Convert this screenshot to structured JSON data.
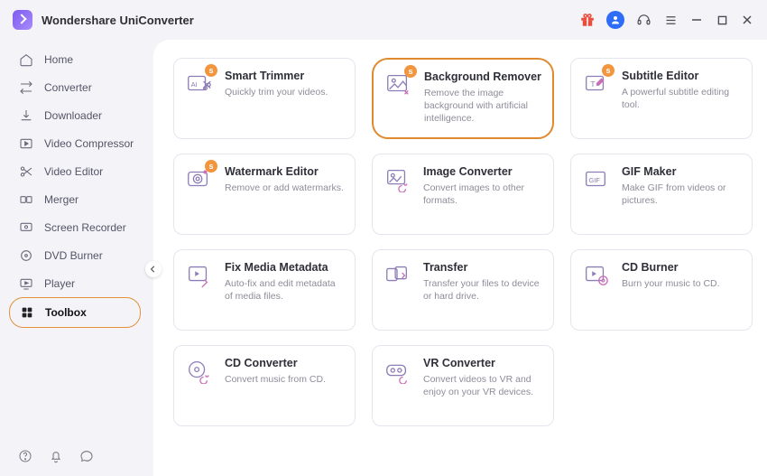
{
  "app": {
    "title": "Wondershare UniConverter"
  },
  "sidebar": {
    "items": [
      {
        "label": "Home"
      },
      {
        "label": "Converter"
      },
      {
        "label": "Downloader"
      },
      {
        "label": "Video Compressor"
      },
      {
        "label": "Video Editor"
      },
      {
        "label": "Merger"
      },
      {
        "label": "Screen Recorder"
      },
      {
        "label": "DVD Burner"
      },
      {
        "label": "Player"
      },
      {
        "label": "Toolbox"
      }
    ],
    "active_index": 9
  },
  "tools": [
    {
      "title": "Smart Trimmer",
      "desc": "Quickly trim your videos.",
      "badge": "s"
    },
    {
      "title": "Background Remover",
      "desc": "Remove the image background with artificial intelligence.",
      "badge": "s",
      "highlight": true
    },
    {
      "title": "Subtitle Editor",
      "desc": "A powerful subtitle editing tool.",
      "badge": "s"
    },
    {
      "title": "Watermark Editor",
      "desc": "Remove or add watermarks.",
      "badge": "s"
    },
    {
      "title": "Image Converter",
      "desc": "Convert images to other formats."
    },
    {
      "title": "GIF Maker",
      "desc": "Make GIF from videos or pictures."
    },
    {
      "title": "Fix Media Metadata",
      "desc": "Auto-fix and edit metadata of media files."
    },
    {
      "title": "Transfer",
      "desc": "Transfer your files to device or hard drive."
    },
    {
      "title": "CD Burner",
      "desc": "Burn your music to CD."
    },
    {
      "title": "CD Converter",
      "desc": "Convert music from CD."
    },
    {
      "title": "VR Converter",
      "desc": "Convert videos to VR and enjoy on your VR devices."
    }
  ]
}
